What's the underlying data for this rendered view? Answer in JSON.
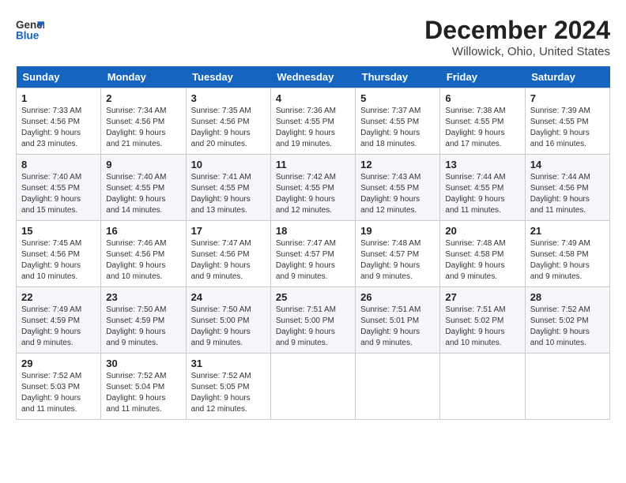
{
  "header": {
    "logo_line1": "General",
    "logo_line2": "Blue",
    "month_title": "December 2024",
    "location": "Willowick, Ohio, United States"
  },
  "weekdays": [
    "Sunday",
    "Monday",
    "Tuesday",
    "Wednesday",
    "Thursday",
    "Friday",
    "Saturday"
  ],
  "weeks": [
    [
      {
        "day": "1",
        "sunrise": "7:33 AM",
        "sunset": "4:56 PM",
        "daylight": "9 hours and 23 minutes."
      },
      {
        "day": "2",
        "sunrise": "7:34 AM",
        "sunset": "4:56 PM",
        "daylight": "9 hours and 21 minutes."
      },
      {
        "day": "3",
        "sunrise": "7:35 AM",
        "sunset": "4:56 PM",
        "daylight": "9 hours and 20 minutes."
      },
      {
        "day": "4",
        "sunrise": "7:36 AM",
        "sunset": "4:55 PM",
        "daylight": "9 hours and 19 minutes."
      },
      {
        "day": "5",
        "sunrise": "7:37 AM",
        "sunset": "4:55 PM",
        "daylight": "9 hours and 18 minutes."
      },
      {
        "day": "6",
        "sunrise": "7:38 AM",
        "sunset": "4:55 PM",
        "daylight": "9 hours and 17 minutes."
      },
      {
        "day": "7",
        "sunrise": "7:39 AM",
        "sunset": "4:55 PM",
        "daylight": "9 hours and 16 minutes."
      }
    ],
    [
      {
        "day": "8",
        "sunrise": "7:40 AM",
        "sunset": "4:55 PM",
        "daylight": "9 hours and 15 minutes."
      },
      {
        "day": "9",
        "sunrise": "7:40 AM",
        "sunset": "4:55 PM",
        "daylight": "9 hours and 14 minutes."
      },
      {
        "day": "10",
        "sunrise": "7:41 AM",
        "sunset": "4:55 PM",
        "daylight": "9 hours and 13 minutes."
      },
      {
        "day": "11",
        "sunrise": "7:42 AM",
        "sunset": "4:55 PM",
        "daylight": "9 hours and 12 minutes."
      },
      {
        "day": "12",
        "sunrise": "7:43 AM",
        "sunset": "4:55 PM",
        "daylight": "9 hours and 12 minutes."
      },
      {
        "day": "13",
        "sunrise": "7:44 AM",
        "sunset": "4:55 PM",
        "daylight": "9 hours and 11 minutes."
      },
      {
        "day": "14",
        "sunrise": "7:44 AM",
        "sunset": "4:56 PM",
        "daylight": "9 hours and 11 minutes."
      }
    ],
    [
      {
        "day": "15",
        "sunrise": "7:45 AM",
        "sunset": "4:56 PM",
        "daylight": "9 hours and 10 minutes."
      },
      {
        "day": "16",
        "sunrise": "7:46 AM",
        "sunset": "4:56 PM",
        "daylight": "9 hours and 10 minutes."
      },
      {
        "day": "17",
        "sunrise": "7:47 AM",
        "sunset": "4:56 PM",
        "daylight": "9 hours and 9 minutes."
      },
      {
        "day": "18",
        "sunrise": "7:47 AM",
        "sunset": "4:57 PM",
        "daylight": "9 hours and 9 minutes."
      },
      {
        "day": "19",
        "sunrise": "7:48 AM",
        "sunset": "4:57 PM",
        "daylight": "9 hours and 9 minutes."
      },
      {
        "day": "20",
        "sunrise": "7:48 AM",
        "sunset": "4:58 PM",
        "daylight": "9 hours and 9 minutes."
      },
      {
        "day": "21",
        "sunrise": "7:49 AM",
        "sunset": "4:58 PM",
        "daylight": "9 hours and 9 minutes."
      }
    ],
    [
      {
        "day": "22",
        "sunrise": "7:49 AM",
        "sunset": "4:59 PM",
        "daylight": "9 hours and 9 minutes."
      },
      {
        "day": "23",
        "sunrise": "7:50 AM",
        "sunset": "4:59 PM",
        "daylight": "9 hours and 9 minutes."
      },
      {
        "day": "24",
        "sunrise": "7:50 AM",
        "sunset": "5:00 PM",
        "daylight": "9 hours and 9 minutes."
      },
      {
        "day": "25",
        "sunrise": "7:51 AM",
        "sunset": "5:00 PM",
        "daylight": "9 hours and 9 minutes."
      },
      {
        "day": "26",
        "sunrise": "7:51 AM",
        "sunset": "5:01 PM",
        "daylight": "9 hours and 9 minutes."
      },
      {
        "day": "27",
        "sunrise": "7:51 AM",
        "sunset": "5:02 PM",
        "daylight": "9 hours and 10 minutes."
      },
      {
        "day": "28",
        "sunrise": "7:52 AM",
        "sunset": "5:02 PM",
        "daylight": "9 hours and 10 minutes."
      }
    ],
    [
      {
        "day": "29",
        "sunrise": "7:52 AM",
        "sunset": "5:03 PM",
        "daylight": "9 hours and 11 minutes."
      },
      {
        "day": "30",
        "sunrise": "7:52 AM",
        "sunset": "5:04 PM",
        "daylight": "9 hours and 11 minutes."
      },
      {
        "day": "31",
        "sunrise": "7:52 AM",
        "sunset": "5:05 PM",
        "daylight": "9 hours and 12 minutes."
      },
      null,
      null,
      null,
      null
    ]
  ]
}
